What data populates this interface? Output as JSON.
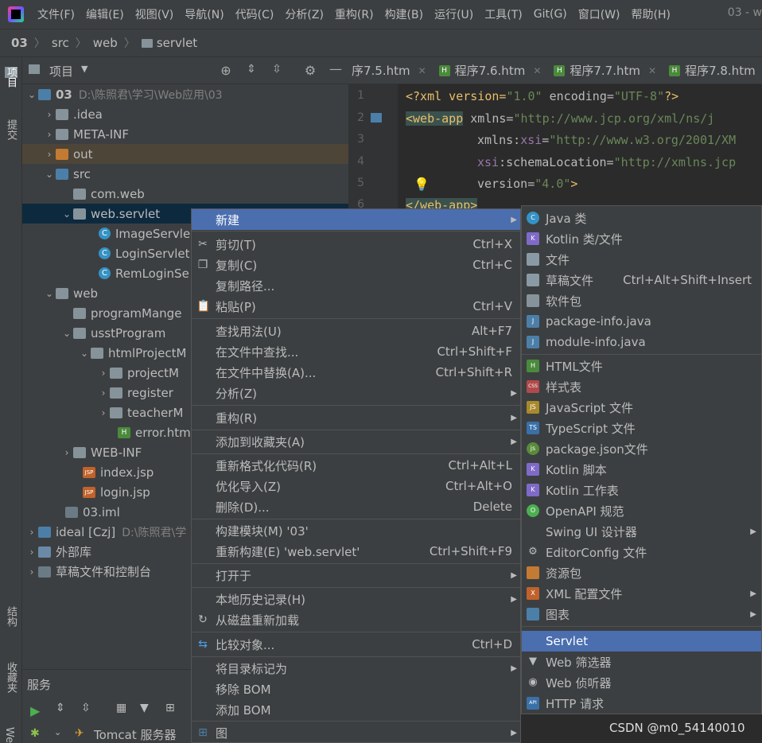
{
  "menubar": {
    "items": [
      "文件(F)",
      "编辑(E)",
      "视图(V)",
      "导航(N)",
      "代码(C)",
      "分析(Z)",
      "重构(R)",
      "构建(B)",
      "运行(U)",
      "工具(T)",
      "Git(G)",
      "窗口(W)",
      "帮助(H)"
    ],
    "title_right": "03 - w"
  },
  "breadcrumb": [
    "03",
    "src",
    "web",
    "servlet"
  ],
  "left_strip": {
    "project_tab": "项目",
    "commit_tab": "提交",
    "structure_tab": "结构",
    "favorites_tab": "收藏夹",
    "web_tab": "Web"
  },
  "project_panel": {
    "title": "项目"
  },
  "tree": [
    {
      "label": "03",
      "extra": "D:\\陈照君\\学习\\Web应用\\03",
      "bold": true
    },
    {
      "label": ".idea"
    },
    {
      "label": "META-INF"
    },
    {
      "label": "out"
    },
    {
      "label": "src"
    },
    {
      "label": "com.web"
    },
    {
      "label": "web.servlet"
    },
    {
      "label": "ImageServle"
    },
    {
      "label": "LoginServlet"
    },
    {
      "label": "RemLoginSe"
    },
    {
      "label": "web"
    },
    {
      "label": "programMange"
    },
    {
      "label": "usstProgram"
    },
    {
      "label": "htmlProjectM"
    },
    {
      "label": "projectM"
    },
    {
      "label": "register"
    },
    {
      "label": "teacherM"
    },
    {
      "label": "error.htm"
    },
    {
      "label": "WEB-INF"
    },
    {
      "label": "index.jsp"
    },
    {
      "label": "login.jsp"
    },
    {
      "label": "03.iml"
    },
    {
      "label": "ideal [Czj]",
      "extra": "D:\\陈照君\\学"
    },
    {
      "label": "外部库"
    },
    {
      "label": "草稿文件和控制台"
    }
  ],
  "services": {
    "title": "服务",
    "tomcat": "Tomcat 服务器"
  },
  "tabs": [
    "序7.5.htm",
    "程序7.6.htm",
    "程序7.7.htm",
    "程序7.8.htm"
  ],
  "code": {
    "line_numbers": [
      "1",
      "2",
      "3",
      "4",
      "5",
      "6"
    ],
    "l1_a": "<?xml version=",
    "l1_b": "\"1.0\"",
    "l1_c": " encoding=",
    "l1_d": "\"UTF-8\"",
    "l1_e": "?>",
    "l2_tag": "<web-app",
    "l2_attr": " xmlns=",
    "l2_val": "\"http://www.jcp.org/xml/ns/j",
    "l3_attr": "xmlns:",
    "l3_ns": "xsi",
    "l3_eq": "=",
    "l3_val": "\"http://www.w3.org/2001/XM",
    "l4_ns": "xsi",
    "l4_attr": ":schemaLocation=",
    "l4_val": "\"http://xmlns.jcp",
    "l5_attr": "version=",
    "l5_val": "\"4.0\"",
    "l5_end": ">",
    "l6_tag": "</web-app>"
  },
  "context_menu": {
    "new": "新建",
    "cut": "剪切(T)",
    "cut_sc": "Ctrl+X",
    "copy": "复制(C)",
    "copy_sc": "Ctrl+C",
    "copy_path": "复制路径...",
    "paste": "粘贴(P)",
    "paste_sc": "Ctrl+V",
    "find_usages": "查找用法(U)",
    "find_usages_sc": "Alt+F7",
    "find_in_files": "在文件中查找...",
    "find_in_files_sc": "Ctrl+Shift+F",
    "replace_in_files": "在文件中替换(A)...",
    "replace_in_files_sc": "Ctrl+Shift+R",
    "analyze": "分析(Z)",
    "refactor": "重构(R)",
    "add_favorites": "添加到收藏夹(A)",
    "reformat": "重新格式化代码(R)",
    "reformat_sc": "Ctrl+Alt+L",
    "optimize_imports": "优化导入(Z)",
    "optimize_imports_sc": "Ctrl+Alt+O",
    "delete": "删除(D)...",
    "delete_sc": "Delete",
    "build_module": "构建模块(M) '03'",
    "rebuild": "重新构建(E) 'web.servlet'",
    "rebuild_sc": "Ctrl+Shift+F9",
    "open_in": "打开于",
    "local_history": "本地历史记录(H)",
    "reload": "从磁盘重新加载",
    "compare": "比较对象...",
    "compare_sc": "Ctrl+D",
    "mark_dir": "将目录标记为",
    "remove_bom": "移除 BOM",
    "add_bom": "添加 BOM",
    "diagram": "图"
  },
  "submenu": [
    {
      "label": "Java 类",
      "icon": "C",
      "color": "#3592c4"
    },
    {
      "label": "Kotlin 类/文件",
      "icon": "K",
      "color": "#7f6ac8"
    },
    {
      "label": "文件",
      "icon": "",
      "color": "#8a9aa4"
    },
    {
      "label": "草稿文件",
      "shortcut": "Ctrl+Alt+Shift+Insert",
      "icon": "",
      "color": "#8a9aa4"
    },
    {
      "label": "软件包",
      "icon": "",
      "color": "#87939a"
    },
    {
      "label": "package-info.java",
      "icon": "J",
      "color": "#4c7fa8"
    },
    {
      "label": "module-info.java",
      "icon": "J",
      "color": "#4c7fa8"
    },
    {
      "label": "HTML文件",
      "icon": "H",
      "color": "#4a8a3b"
    },
    {
      "label": "样式表",
      "icon": "CSS",
      "color": "#b04a4a"
    },
    {
      "label": "JavaScript 文件",
      "icon": "JS",
      "color": "#a88a2a"
    },
    {
      "label": "TypeScript 文件",
      "icon": "TS",
      "color": "#3a70a8"
    },
    {
      "label": "package.json文件",
      "icon": "js",
      "color": "#5a8a3a"
    },
    {
      "label": "Kotlin 脚本",
      "icon": "K",
      "color": "#7f6ac8"
    },
    {
      "label": "Kotlin 工作表",
      "icon": "K",
      "color": "#7f6ac8"
    },
    {
      "label": "OpenAPI 规范",
      "icon": "O",
      "color": "#4caf50"
    },
    {
      "label": "Swing UI 设计器",
      "icon": "",
      "color": "transparent",
      "sub": true
    },
    {
      "label": "EditorConfig 文件",
      "icon": "⚙",
      "color": "transparent"
    },
    {
      "label": "资源包",
      "icon": "",
      "color": "#c37a32"
    },
    {
      "label": "XML 配置文件",
      "icon": "X",
      "color": "#c0622b",
      "sub": true
    },
    {
      "label": "图表",
      "icon": "",
      "color": "#4c7fa8",
      "sub": true
    },
    {
      "label": "Servlet",
      "icon": "",
      "color": "transparent",
      "selected": true
    },
    {
      "label": "Web 筛选器",
      "icon": "▼",
      "color": "transparent"
    },
    {
      "label": "Web 侦听器",
      "icon": "◉",
      "color": "transparent"
    },
    {
      "label": "HTTP 请求",
      "icon": "API",
      "color": "#3a70a8"
    }
  ],
  "watermark": "CSDN @m0_54140010"
}
